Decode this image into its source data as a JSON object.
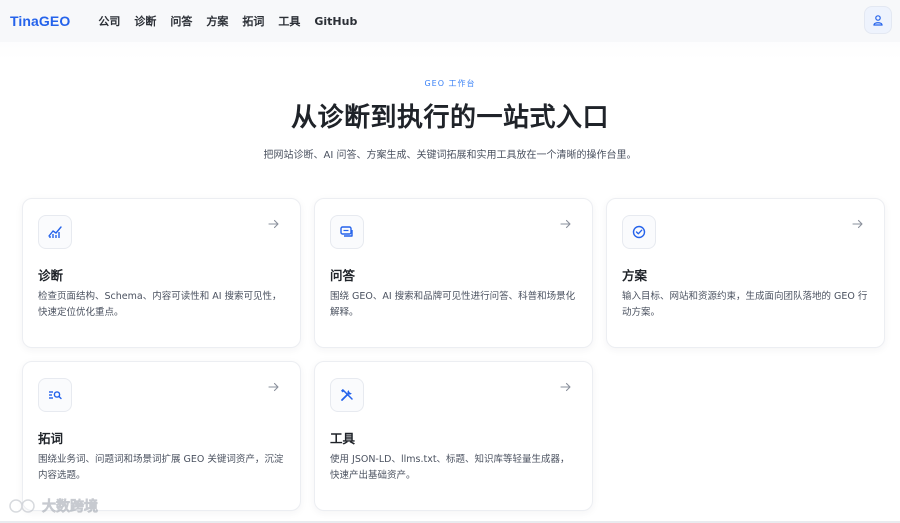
{
  "header": {
    "brand": "TinaGEO",
    "nav": [
      "公司",
      "诊断",
      "问答",
      "方案",
      "拓词",
      "工具",
      "GitHub"
    ],
    "avatar_icon": "user-icon"
  },
  "hero": {
    "eyebrow": "GEO 工作台",
    "title": "从诊断到执行的一站式入口",
    "subtitle": "把网站诊断、AI 问答、方案生成、关键词拓展和实用工具放在一个清晰的操作台里。"
  },
  "cards": [
    {
      "icon": "chart-icon",
      "title": "诊断",
      "desc": "检查页面结构、Schema、内容可读性和 AI 搜索可见性，快速定位优化重点。"
    },
    {
      "icon": "chat-icon",
      "title": "问答",
      "desc": "围绕 GEO、AI 搜索和品牌可见性进行问答、科普和场景化解释。"
    },
    {
      "icon": "check-circle-icon",
      "title": "方案",
      "desc": "输入目标、网站和资源约束，生成面向团队落地的 GEO 行动方案。"
    },
    {
      "icon": "list-search-icon",
      "title": "拓词",
      "desc": "围绕业务词、问题词和场景词扩展 GEO 关键词资产，沉淀内容选题。"
    },
    {
      "icon": "tools-icon",
      "title": "工具",
      "desc": "使用 JSON-LD、llms.txt、标题、知识库等轻量生成器，快速产出基础资产。"
    }
  ],
  "watermark": {
    "text": "大数跨境"
  },
  "colors": {
    "accent": "#2563eb",
    "text": "#1f2329",
    "muted": "#4b5260"
  }
}
